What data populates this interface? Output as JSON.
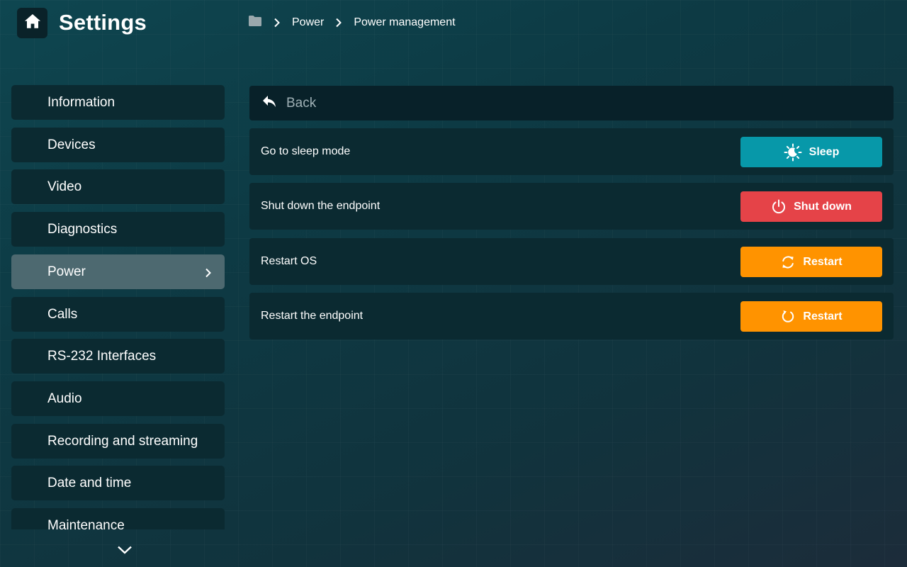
{
  "header": {
    "title": "Settings",
    "home_icon": "home-icon"
  },
  "breadcrumb": {
    "root_icon": "folder-icon",
    "items": [
      "Power",
      "Power management"
    ]
  },
  "sidebar": {
    "items": [
      {
        "label": "Information",
        "active": false
      },
      {
        "label": "Devices",
        "active": false
      },
      {
        "label": "Video",
        "active": false
      },
      {
        "label": "Diagnostics",
        "active": false
      },
      {
        "label": "Power",
        "active": true
      },
      {
        "label": "Calls",
        "active": false
      },
      {
        "label": "RS-232 Interfaces",
        "active": false
      },
      {
        "label": "Audio",
        "active": false
      },
      {
        "label": "Recording and streaming",
        "active": false
      },
      {
        "label": "Date and time",
        "active": false
      },
      {
        "label": "Maintenance",
        "active": false
      }
    ]
  },
  "main": {
    "back_label": "Back",
    "rows": [
      {
        "label": "Go to sleep mode",
        "button": "Sleep",
        "icon": "sleep-icon",
        "color": "#0798a9"
      },
      {
        "label": "Shut down the endpoint",
        "button": "Shut down",
        "icon": "power-icon",
        "color": "#e54348"
      },
      {
        "label": "Restart OS",
        "button": "Restart",
        "icon": "restart-icon",
        "color": "#ff9300"
      },
      {
        "label": "Restart the endpoint",
        "button": "Restart",
        "icon": "restart-icon",
        "color": "#ff9300"
      }
    ]
  },
  "colors": {
    "accent_active": "#4d6970",
    "panel": "#0b2a31",
    "back_bar": "#082129"
  }
}
